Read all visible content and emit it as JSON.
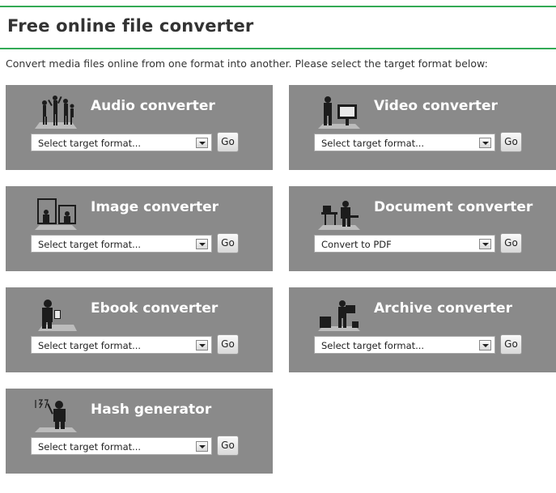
{
  "header": {
    "title": "Free online file converter",
    "intro": "Convert media files online from one format into another. Please select the target format below:"
  },
  "colors": {
    "accent_rule": "#33aa55",
    "card_bg": "#8a8a8a"
  },
  "converters": [
    {
      "title": "Audio converter",
      "selected": "Select target format...",
      "go": "Go",
      "icon": "dancers-icon"
    },
    {
      "title": "Video converter",
      "selected": "Select target format...",
      "go": "Go",
      "icon": "video-viewer-icon"
    },
    {
      "title": "Image converter",
      "selected": "Select target format...",
      "go": "Go",
      "icon": "picture-frames-icon"
    },
    {
      "title": "Document converter",
      "selected": "Convert to PDF",
      "go": "Go",
      "icon": "desk-worker-icon"
    },
    {
      "title": "Ebook converter",
      "selected": "Select target format...",
      "go": "Go",
      "icon": "reader-icon"
    },
    {
      "title": "Archive converter",
      "selected": "Select target format...",
      "go": "Go",
      "icon": "box-carrier-icon"
    },
    {
      "title": "Hash generator",
      "selected": "Select target format...",
      "go": "Go",
      "icon": "hash-writer-icon"
    }
  ]
}
